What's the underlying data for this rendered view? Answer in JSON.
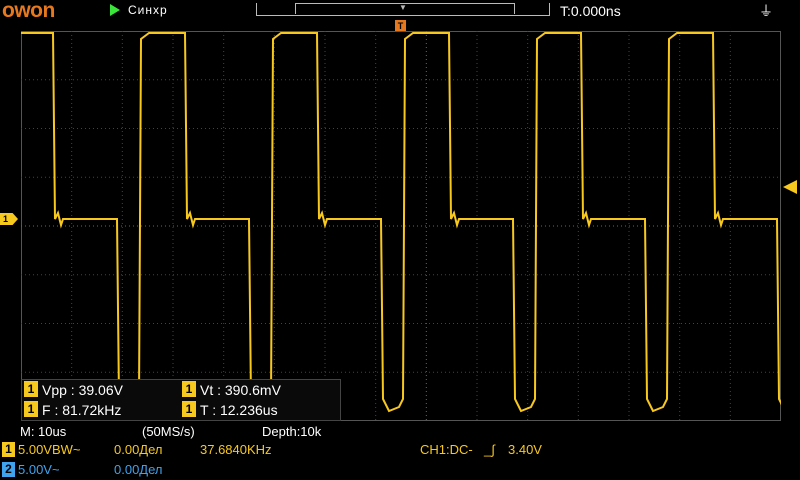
{
  "header": {
    "logo": "owon",
    "run_state": "Синхр",
    "trigger_time": "T:0.000ns",
    "usb_icon": "usb-icon",
    "trigger_marker": "T"
  },
  "channel_marker": "1",
  "measurements": [
    {
      "ch": "1",
      "text": "Vpp : 39.06V"
    },
    {
      "ch": "1",
      "text": "Vt : 390.6mV"
    },
    {
      "ch": "1",
      "text": "F : 81.72kHz"
    },
    {
      "ch": "1",
      "text": "T : 12.236us"
    }
  ],
  "timebase": {
    "main": "M: 10us",
    "sample_rate": "(50MS/s)",
    "depth": "Depth:10k"
  },
  "channels": [
    {
      "num": "1",
      "volts": "5.00VBW~",
      "offset": "0.00Дел",
      "freq": "37.6840KHz",
      "trigger": "CH1:DC-",
      "level": "3.40V",
      "color": "#f7c81e"
    },
    {
      "num": "2",
      "volts": "5.00V~",
      "offset": "0.00Дел",
      "color": "#3fa3f0"
    }
  ],
  "colors": {
    "ch1": "#f7c81e",
    "ch2": "#3fa3f0",
    "brand": "#e8781e",
    "run": "#39e639"
  }
}
